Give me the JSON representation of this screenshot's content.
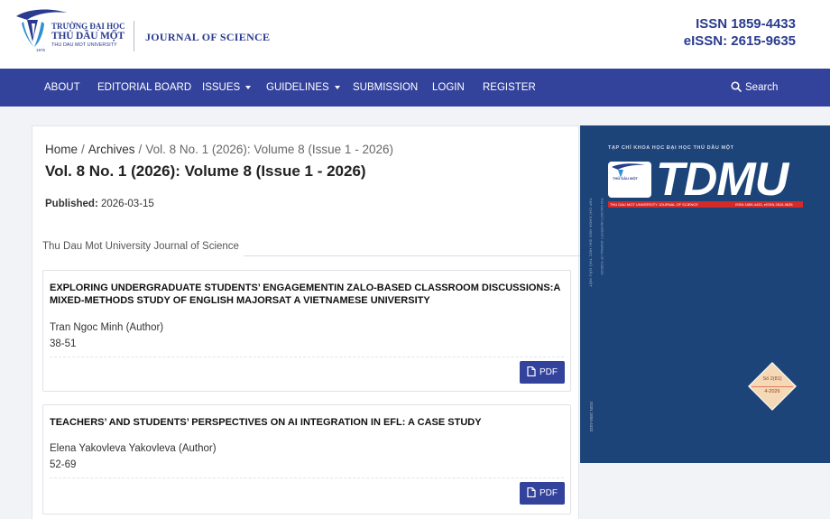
{
  "colors": {
    "brand": "#33429b",
    "brand_dark": "#2a3b8f",
    "cover_bg": "#1c4478",
    "cover_red": "#d42a2a"
  },
  "header": {
    "logo": {
      "name_line1": "TRƯỜNG ĐẠI HỌC",
      "name_line2": "THỦ DẦU MỘT",
      "name_line3": "THU DAU MOT UNIVERSITY",
      "year": "1976"
    },
    "journal_name": "JOURNAL OF SCIENCE",
    "issn": "ISSN 1859-4433",
    "eissn": "eISSN: 2615-9635"
  },
  "nav": {
    "items": [
      {
        "label": "ABOUT"
      },
      {
        "label": "EDITORIAL BOARD"
      },
      {
        "label": "ISSUES",
        "dropdown": true
      },
      {
        "label": "GUIDELINES",
        "dropdown": true
      },
      {
        "label": "SUBMISSION"
      },
      {
        "label": "LOGIN"
      },
      {
        "label": "REGISTER"
      }
    ],
    "search_label": "Search",
    "search_icon": "search-icon"
  },
  "breadcrumb": {
    "home": "Home",
    "separator": "/",
    "archives": "Archives",
    "current": "Vol. 8 No. 1 (2026): Volume 8 (Issue 1 - 2026)"
  },
  "issue": {
    "title": "Vol. 8 No. 1 (2026): Volume 8 (Issue 1 - 2026)",
    "published_label": "Published:",
    "published_date": "2026-03-15",
    "section": "Thu Dau Mot University Journal of Science"
  },
  "articles": [
    {
      "title": "EXPLORING UNDERGRADUATE STUDENTS’ ENGAGEMENTIN ZALO-BASED CLASSROOM DISCUSSIONS:A MIXED-METHODS STUDY OF ENGLISH MAJORSAT A VIETNAMESE UNIVERSITY",
      "author": "Tran Ngoc Minh (Author)",
      "pages": "38-51",
      "pdf_label": "PDF"
    },
    {
      "title": "TEACHERS’ AND STUDENTS’ PERSPECTIVES ON AI INTEGRATION IN EFL: A CASE STUDY",
      "author": "Elena Yakovleva Yakovleva (Author)",
      "pages": "52-69",
      "pdf_label": "PDF"
    }
  ],
  "cover": {
    "top_text": "TẠP CHÍ KHOA HỌC ĐẠI HỌC THỦ DẦU MỘT",
    "wordmark": "TDMU",
    "logo_text": "THỦ DẦU MỘT",
    "red_band_text": "THU DAU MOT UNIVERSITY JOURNAL OF SCIENCE",
    "red_band_issn": "ISSN 1859-4433, eISSN 2615-9635",
    "side_text": "TẠP CHÍ KHOA HỌC ĐẠI HỌC THỦ DẦU MỘT",
    "side_text2": "THU DAU MOT UNIVERSITY JOURNAL OF SCIENCE",
    "side_issn": "ISSN 1859-4433",
    "badge_line1": "Số 2(81)",
    "badge_line2": "4-2026"
  }
}
